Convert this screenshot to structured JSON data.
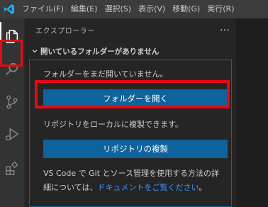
{
  "menu": [
    "ファイル(F)",
    "編集(E)",
    "選択(S)",
    "表示(V)",
    "移動(G)",
    "実行(R)"
  ],
  "sidebar": {
    "title": "エクスプローラー",
    "more_icon": "…",
    "section_title": "開いているフォルダーがありません",
    "no_folder_text": "フォルダーをまだ開いていません。",
    "open_folder_button": "フォルダーを開く",
    "clone_text": "リポジトリをローカルに複製できます。",
    "clone_button": "リポジトリの複製",
    "git_text_line1": "VS Code で Git とソース管理を使用する方法の詳",
    "git_text_line2_prefix": "細については、",
    "git_text_link": "ドキュメントをご覧ください",
    "git_text_line2_suffix": "。"
  },
  "icons": {
    "app": "vscode-logo-icon",
    "activity": [
      "explorer-icon",
      "search-icon",
      "source-control-icon",
      "run-debug-icon",
      "extensions-icon"
    ]
  },
  "colors": {
    "accent_button": "#0e639c",
    "highlight_box": "#e50914",
    "link": "#3794ff"
  }
}
